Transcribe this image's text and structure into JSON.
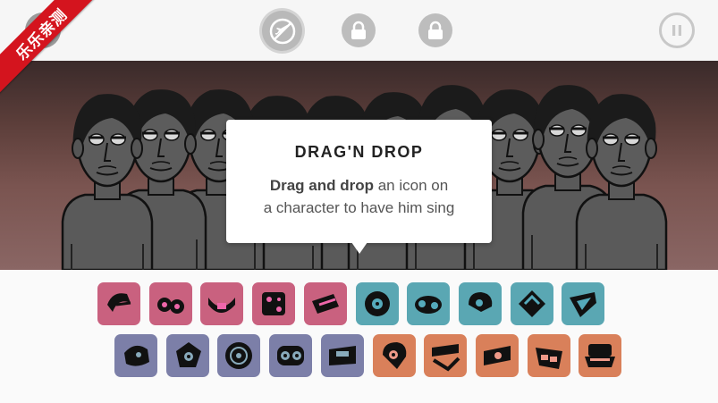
{
  "watermark": "乐乐亲测",
  "tooltip": {
    "title": "DRAG'N DROP",
    "body_bold": "Drag and drop",
    "body_rest_1": " an icon on",
    "body_line2": "a character to have him sing"
  },
  "toolbar": {
    "buttons": [
      {
        "name": "airplane-mode-button",
        "icon": "airplane-icon"
      },
      {
        "name": "locked-bonus-button-1",
        "icon": "lock-icon"
      },
      {
        "name": "locked-bonus-button-2",
        "icon": "lock-icon"
      },
      {
        "name": "pause-button",
        "icon": "pause-icon"
      }
    ]
  },
  "colors": {
    "beats": "#c9617f",
    "effects": "#5aa7b3",
    "melodies": "#7c7fa8",
    "voices": "#d9805a"
  },
  "icons": {
    "row1": [
      {
        "name": "beat-icon-1",
        "group": "beats"
      },
      {
        "name": "beat-icon-2",
        "group": "beats"
      },
      {
        "name": "beat-icon-3",
        "group": "beats"
      },
      {
        "name": "beat-icon-4",
        "group": "beats"
      },
      {
        "name": "beat-icon-5",
        "group": "beats"
      },
      {
        "name": "effect-icon-1",
        "group": "effects"
      },
      {
        "name": "effect-icon-2",
        "group": "effects"
      },
      {
        "name": "effect-icon-3",
        "group": "effects"
      },
      {
        "name": "effect-icon-4",
        "group": "effects"
      },
      {
        "name": "effect-icon-5",
        "group": "effects"
      }
    ],
    "row2": [
      {
        "name": "melody-icon-1",
        "group": "melodies"
      },
      {
        "name": "melody-icon-2",
        "group": "melodies"
      },
      {
        "name": "melody-icon-3",
        "group": "melodies"
      },
      {
        "name": "melody-icon-4",
        "group": "melodies"
      },
      {
        "name": "melody-icon-5",
        "group": "melodies"
      },
      {
        "name": "voice-icon-1",
        "group": "voices"
      },
      {
        "name": "voice-icon-2",
        "group": "voices"
      },
      {
        "name": "voice-icon-3",
        "group": "voices"
      },
      {
        "name": "voice-icon-4",
        "group": "voices"
      },
      {
        "name": "voice-icon-5",
        "group": "voices"
      }
    ]
  }
}
